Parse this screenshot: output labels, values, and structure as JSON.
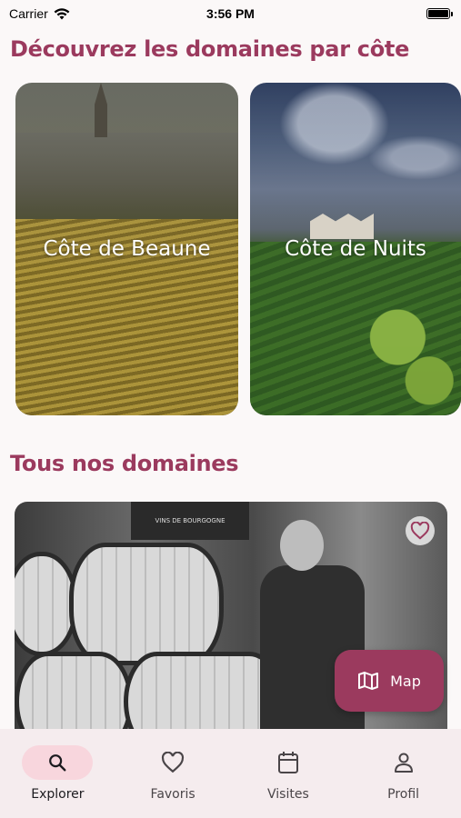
{
  "status_bar": {
    "carrier": "Carrier",
    "time": "3:56 PM"
  },
  "sections": {
    "cotes_title": "Découvrez les domaines par côte",
    "domaines_title": "Tous nos domaines"
  },
  "regions": [
    {
      "label": "Côte de Beaune"
    },
    {
      "label": "Côte de Nuits"
    }
  ],
  "domaine_card": {
    "sign_text": "VINS DE BOURGOGNE"
  },
  "map_button": {
    "label": "Map"
  },
  "bottom_nav": [
    {
      "label": "Explorer",
      "icon": "search-icon",
      "active": true
    },
    {
      "label": "Favoris",
      "icon": "heart-icon",
      "active": false
    },
    {
      "label": "Visites",
      "icon": "calendar-icon",
      "active": false
    },
    {
      "label": "Profil",
      "icon": "person-icon",
      "active": false
    }
  ],
  "colors": {
    "accent": "#9b3a5e",
    "nav_active_pill": "#f8d6dd",
    "nav_background": "#f5ecee"
  }
}
